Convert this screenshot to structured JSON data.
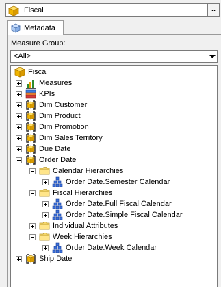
{
  "cube_selector": {
    "value": "Fiscal",
    "browse_label": ".."
  },
  "tabs": [
    {
      "label": "Metadata"
    }
  ],
  "measure_group": {
    "label": "Measure Group:",
    "value": "<All>"
  },
  "tree": {
    "root": "Fiscal",
    "items": [
      {
        "label": "Measures"
      },
      {
        "label": "KPIs"
      },
      {
        "label": "Dim Customer"
      },
      {
        "label": "Dim Product"
      },
      {
        "label": "Dim Promotion"
      },
      {
        "label": "Dim Sales Territory"
      },
      {
        "label": "Due Date"
      },
      {
        "label": "Order Date"
      },
      {
        "label": "Calendar Hierarchies"
      },
      {
        "label": "Order Date.Semester Calendar"
      },
      {
        "label": "Fiscal Hierarchies"
      },
      {
        "label": "Order Date.Full Fiscal Calendar"
      },
      {
        "label": "Order Date.Simple Fiscal Calendar"
      },
      {
        "label": "Individual Attributes"
      },
      {
        "label": "Week Hierarchies"
      },
      {
        "label": "Order Date.Week Calendar"
      },
      {
        "label": "Ship Date"
      }
    ]
  }
}
